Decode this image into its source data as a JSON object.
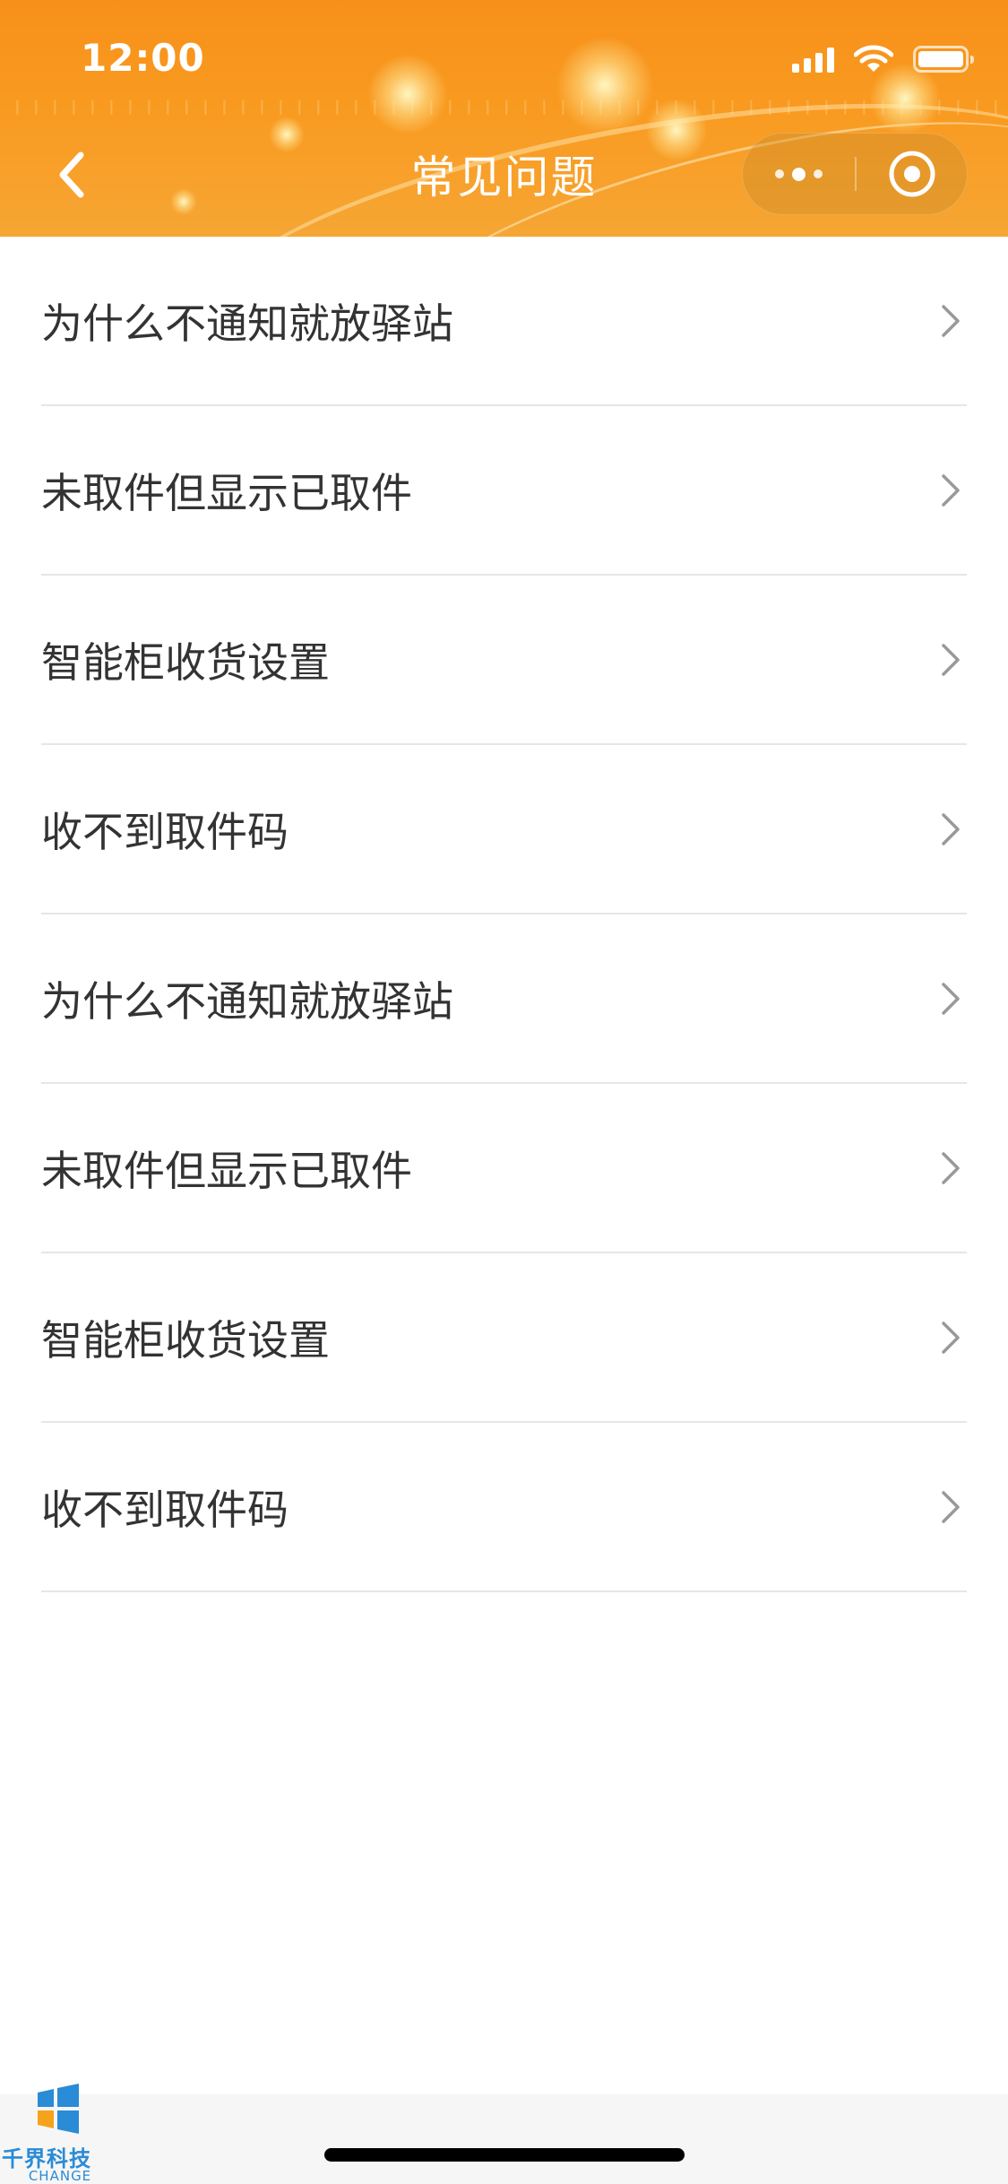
{
  "status_bar": {
    "time": "12:00",
    "icons": [
      "signal-icon",
      "wifi-icon",
      "battery-icon"
    ]
  },
  "nav": {
    "title": "常见问题",
    "back_icon": "chevron-left-icon",
    "more_icon": "more-dots-icon",
    "close_icon": "close-circle-icon"
  },
  "faq": {
    "items": [
      {
        "label": "为什么不通知就放驿站"
      },
      {
        "label": "未取件但显示已取件"
      },
      {
        "label": "智能柜收货设置"
      },
      {
        "label": "收不到取件码"
      },
      {
        "label": "为什么不通知就放驿站"
      },
      {
        "label": "未取件但显示已取件"
      },
      {
        "label": "智能柜收货设置"
      },
      {
        "label": "收不到取件码"
      }
    ],
    "chevron_icon": "chevron-right-icon"
  },
  "watermark": {
    "title": "千界科技",
    "subtitle": "CHANGE"
  },
  "colors": {
    "header_orange": "#f99a20",
    "text": "#333333",
    "divider": "#e6e6e6",
    "chevron": "#999999",
    "watermark_blue": "#2a8bd6"
  }
}
